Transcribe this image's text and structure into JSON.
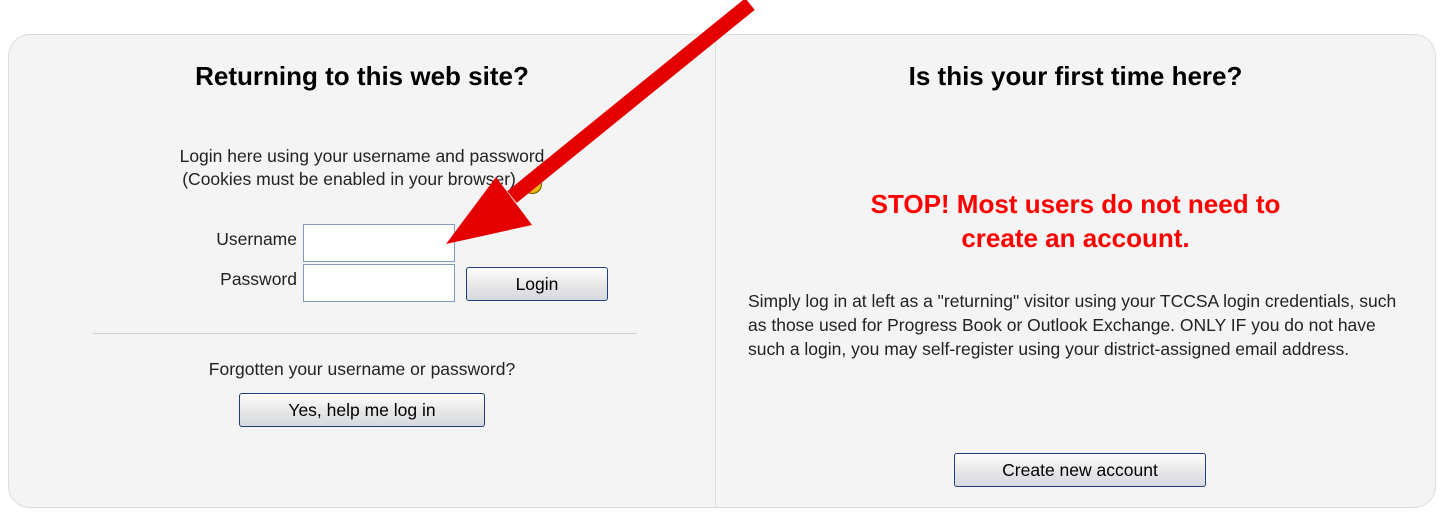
{
  "login": {
    "heading": "Returning to this web site?",
    "intro_line1": "Login here using your username and password",
    "intro_line2": "(Cookies must be enabled in your browser)",
    "help_icon_glyph": "?",
    "username_label": "Username",
    "username_value": "",
    "password_label": "Password",
    "password_value": "",
    "login_button": "Login",
    "forgot_text": "Forgotten your username or password?",
    "help_button": "Yes, help me log in"
  },
  "signup": {
    "heading": "Is this your first time here?",
    "stop_line1": "STOP! Most users do not need to",
    "stop_line2": "create an account.",
    "explanation": "Simply log in at left as a \"returning\" visitor using your TCCSA login credentials, such as those used for Progress Book or Outlook Exchange. ONLY IF you do not have such a login, you may self-register using your district-assigned email address.",
    "create_button": "Create new account"
  },
  "colors": {
    "panel_bg": "#f4f4f4",
    "stop_text": "#ff0000",
    "annotation_arrow": "#e50000",
    "button_border": "#1e3f7a"
  },
  "icons": {
    "help": "help-icon",
    "annotation": "arrow-annotation-icon"
  }
}
